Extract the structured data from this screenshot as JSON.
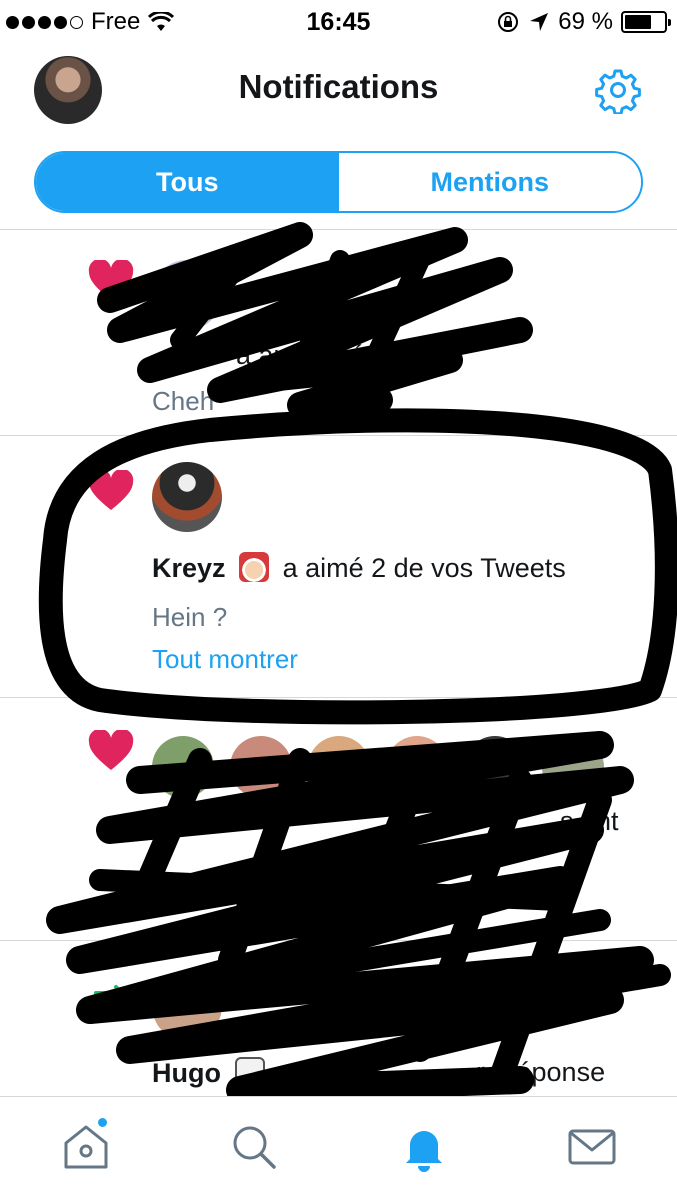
{
  "status_bar": {
    "carrier": "Free",
    "time": "16:45",
    "battery_text": "69 %",
    "battery_level": 0.69
  },
  "header": {
    "title": "Notifications",
    "avatar_icon": "profile-avatar",
    "settings_icon": "gear-icon"
  },
  "segment": {
    "tabs": [
      {
        "label": "Tous",
        "active": true
      },
      {
        "label": "Mentions",
        "active": false
      }
    ]
  },
  "notifications": [
    {
      "icon": "heart-icon",
      "text_visible": "a ai    otre ré  nse",
      "sub": "Cheh",
      "redacted": true
    },
    {
      "icon": "heart-icon",
      "user": "Kreyz",
      "user_emoji": "santa-emoji",
      "action": "a aimé 2 de vos Tweets",
      "sub": "Hein ?",
      "link": "Tout montrer",
      "redacted": false
    },
    {
      "icon": "heart-icon",
      "text_visible": "s ont",
      "redacted": true
    },
    {
      "icon": "retweet-icon",
      "user": "Hugo",
      "user_emoji": "dice-emoji",
      "action_visible": "a",
      "action_tail": "re réponse",
      "redacted": true
    }
  ],
  "tabbar": {
    "items": [
      {
        "name": "home-icon",
        "active": false,
        "has_badge": true
      },
      {
        "name": "search-icon",
        "active": false
      },
      {
        "name": "bell-icon",
        "active": true
      },
      {
        "name": "mail-icon",
        "active": false
      }
    ]
  },
  "colors": {
    "accent": "#1da1f2",
    "heart": "#e0245e",
    "retweet": "#17bf63",
    "secondary_text": "#657786"
  }
}
